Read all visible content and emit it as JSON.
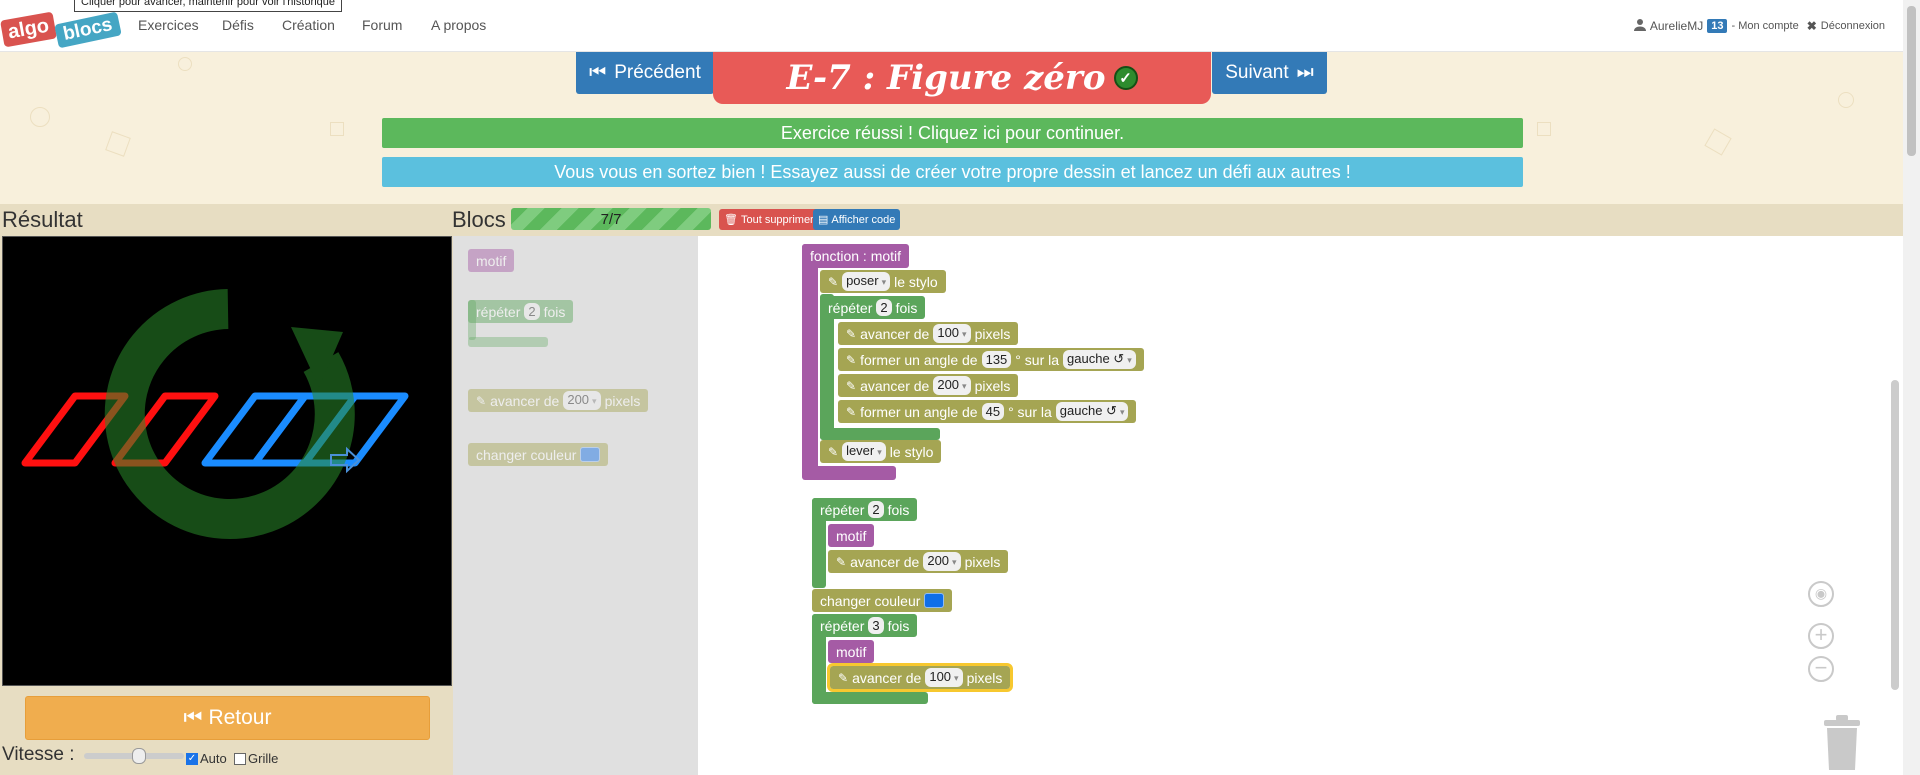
{
  "navbar": {
    "logo": {
      "part1": "algo",
      "part2": "blocs"
    },
    "tooltip": "Cliquer pour avancer, maintenir pour voir l'historique",
    "items": [
      "Exercices",
      "Défis",
      "Création",
      "Forum",
      "A propos"
    ],
    "user": {
      "name": "AurelieMJ",
      "badge": "13",
      "account": "- Mon compte",
      "logout": "Déconnexion"
    }
  },
  "header": {
    "prev_label": "Précédent",
    "next_label": "Suivant",
    "title": "E-7 : Figure zéro",
    "banner_success": "Exercice réussi ! Cliquez ici pour continuer.",
    "banner_info": "Vous vous en sortez bien ! Essayez aussi de créer votre propre dessin et lancez un défi aux autres !"
  },
  "labels": {
    "result": "Résultat",
    "blocs": "Blocs",
    "progress": "7/7",
    "delete_all": "Tout supprimer",
    "show_code": "Afficher code"
  },
  "controls": {
    "retour": "Retour",
    "vitesse": "Vitesse :",
    "auto": "Auto",
    "grille": "Grille",
    "auto_checked": true,
    "grille_checked": false
  },
  "toolbox": {
    "motif": "motif",
    "repeat": {
      "pre": "répéter",
      "n": "2",
      "post": "fois"
    },
    "forward": {
      "pre": "avancer de",
      "val": "200",
      "post": "pixels"
    },
    "color": {
      "label": "changer couleur"
    }
  },
  "program": {
    "function": {
      "header": "fonction : motif",
      "pen_down": {
        "val": "poser",
        "post": "le stylo"
      },
      "repeat": {
        "pre": "répéter",
        "n": "2",
        "post": "fois"
      },
      "lines": [
        {
          "pre": "avancer de",
          "val": "100",
          "post": "pixels"
        },
        {
          "pre": "former un angle de",
          "val": "135",
          "mid": "° sur la",
          "dir": "gauche ↺"
        },
        {
          "pre": "avancer de",
          "val": "200",
          "post": "pixels"
        },
        {
          "pre": "former un angle de",
          "val": "45",
          "mid": "° sur la",
          "dir": "gauche ↺"
        }
      ],
      "pen_up": {
        "val": "lever",
        "post": "le stylo"
      }
    },
    "main": {
      "repeat1": {
        "pre": "répéter",
        "n": "2",
        "post": "fois"
      },
      "motif1": "motif",
      "fwd1": {
        "pre": "avancer de",
        "val": "200",
        "post": "pixels"
      },
      "color": "changer couleur",
      "repeat2": {
        "pre": "répéter",
        "n": "3",
        "post": "fois"
      },
      "motif2": "motif",
      "fwd2": {
        "pre": "avancer de",
        "val": "100",
        "post": "pixels"
      }
    }
  },
  "colors": {
    "accent": "#337ab7",
    "title_bg": "#e85a57",
    "success": "#5cb85c",
    "info": "#5bc0de",
    "warning": "#f0ad4e",
    "danger": "#d9534f",
    "pen_red": "#ff0000",
    "pen_blue": "#1a73e8"
  }
}
